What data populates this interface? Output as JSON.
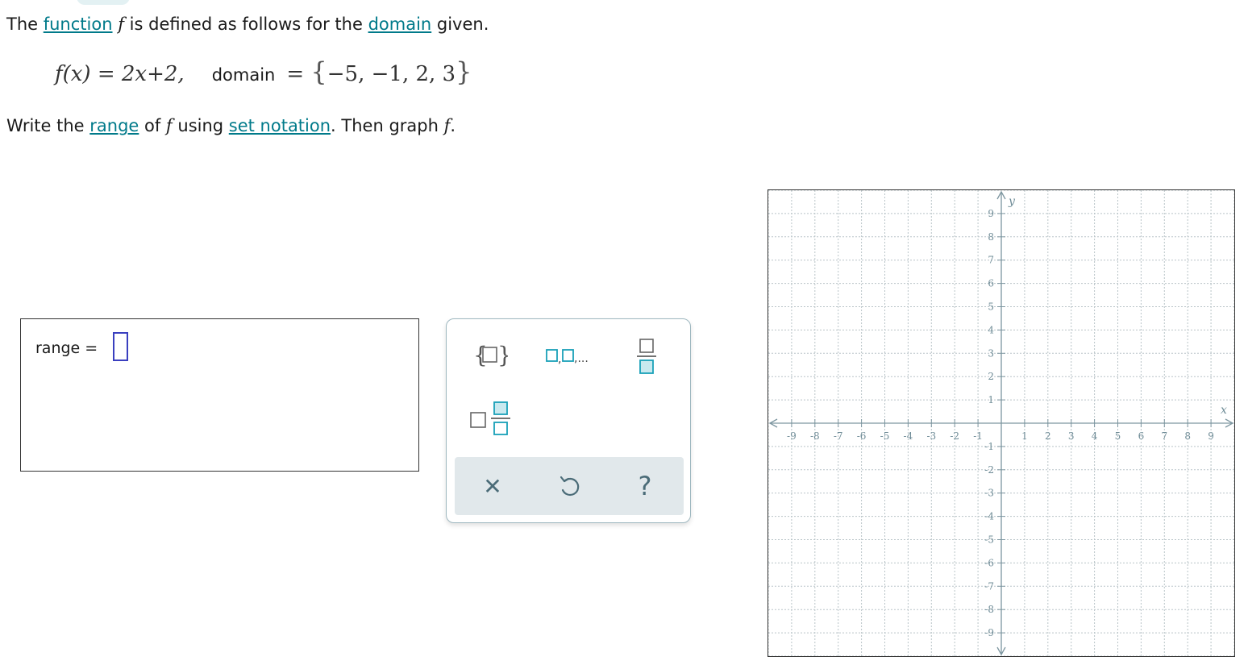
{
  "problem": {
    "line1": {
      "t1": "The ",
      "link_function": "function",
      "var_f": "f",
      "t2": " is defined as follows for the ",
      "link_domain": "domain",
      "t3": " given."
    },
    "formula": {
      "lhs": "f(x) = 2x+2,",
      "domain_word": "domain",
      "eq": "=",
      "open_brace": "{",
      "domain_values": "−5, −1, 2, 3",
      "close_brace": "}"
    },
    "line3": {
      "t1": "Write the ",
      "link_range": "range",
      "t2": " of ",
      "var_f": "f",
      "t3": " using ",
      "link_set_notation": "set notation",
      "t4": ". Then graph ",
      "var_f2": "f",
      "t5": "."
    }
  },
  "answer": {
    "label": "range ="
  },
  "palette": {
    "buttons": [
      {
        "name": "set-braces-icon"
      },
      {
        "name": "list-separator-icon",
        "label": ",..."
      },
      {
        "name": "fraction-icon"
      },
      {
        "name": "mixed-number-icon"
      }
    ],
    "footer": [
      {
        "name": "clear-icon",
        "glyph": "✕"
      },
      {
        "name": "undo-icon"
      },
      {
        "name": "help-icon",
        "glyph": "?"
      }
    ]
  },
  "graph": {
    "x_axis_label": "x",
    "y_axis_label": "y",
    "x_min": -10,
    "x_max": 10,
    "y_min": -10,
    "y_max": 10,
    "x_ticks": [
      "-9",
      "-8",
      "-7",
      "-6",
      "-5",
      "-4",
      "-3",
      "-2",
      "-1",
      "1",
      "2",
      "3",
      "4",
      "5",
      "6",
      "7",
      "8",
      "9"
    ],
    "y_ticks": [
      "9",
      "8",
      "7",
      "6",
      "5",
      "4",
      "3",
      "2",
      "1",
      "-1",
      "-2",
      "-3",
      "-4",
      "-5",
      "-6",
      "-7",
      "-8",
      "-9"
    ],
    "grid_color": "#b9c4c8",
    "axis_color": "#7d96a0",
    "tick_label_color": "#6f8c97"
  },
  "colors": {
    "link": "#007a8a",
    "palette_accent": "#1aa0b8",
    "answer_slot": "#3a3fbf"
  }
}
